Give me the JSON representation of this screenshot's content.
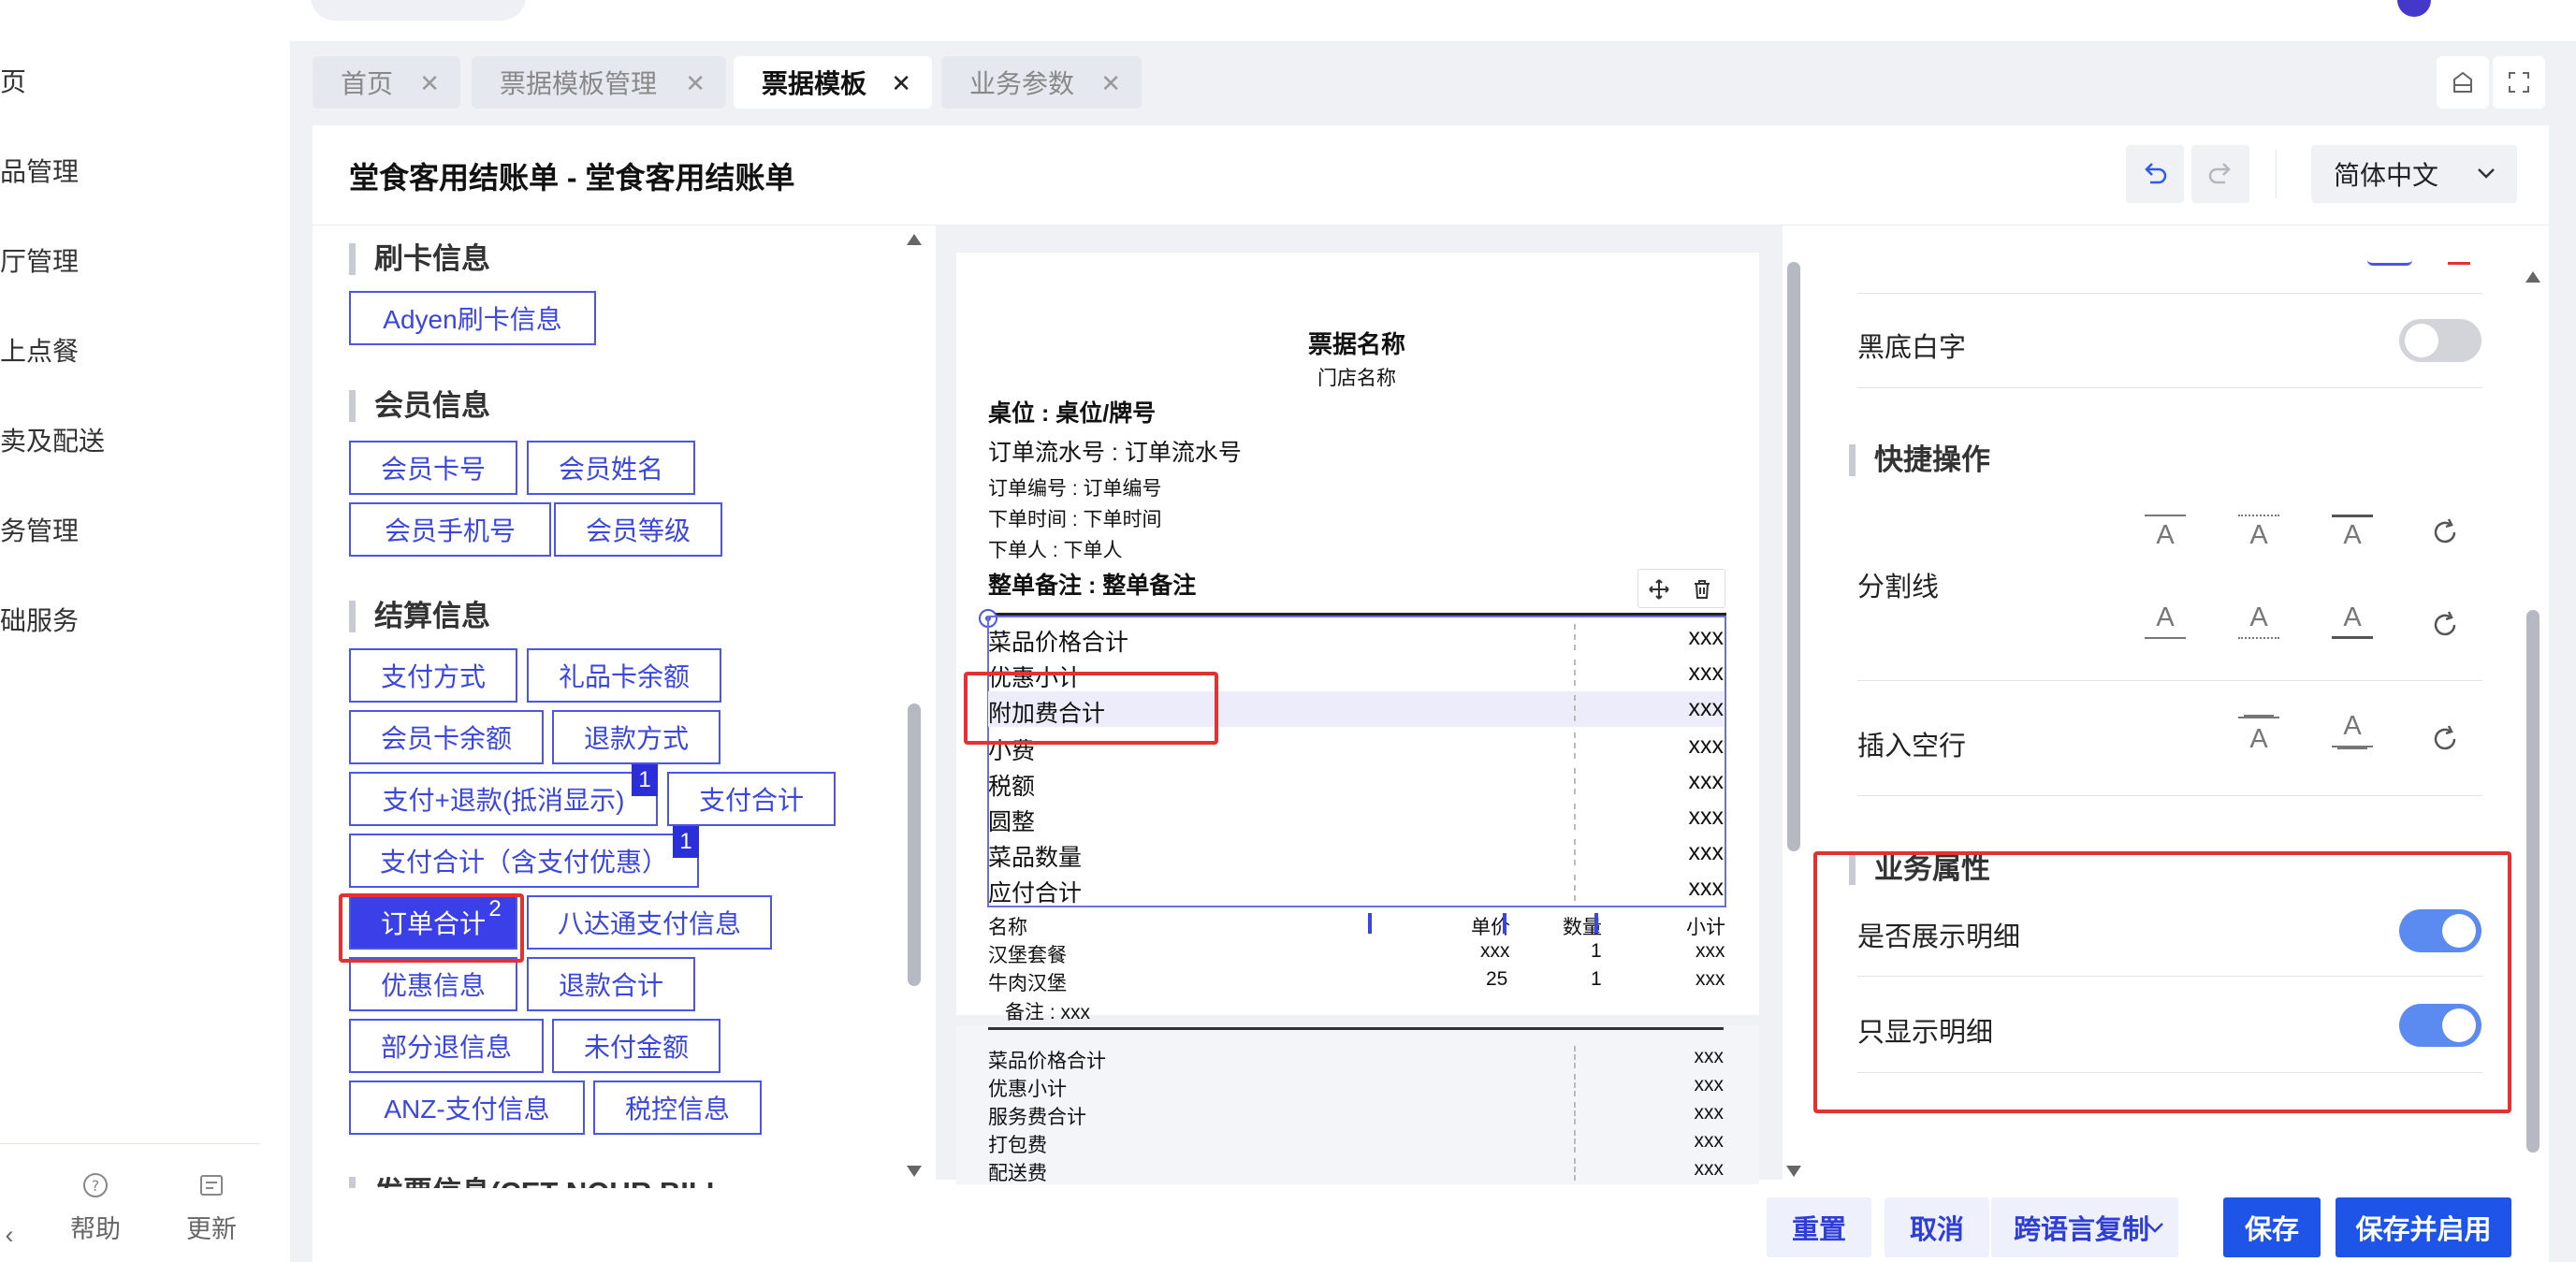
{
  "sidebar": {
    "items": [
      "页",
      "品管理",
      "厅管理",
      "上点餐",
      "卖及配送",
      "务管理",
      "础服务"
    ],
    "footer": {
      "help": "帮助",
      "update": "更新"
    }
  },
  "tabs": [
    {
      "label": "首页"
    },
    {
      "label": "票据模板管理"
    },
    {
      "label": "票据模板"
    },
    {
      "label": "业务参数"
    }
  ],
  "header": {
    "title": "堂食客用结账单 - 堂食客用结账单",
    "language": "简体中文"
  },
  "fields": {
    "card_section": "刷卡信息",
    "card_buttons": [
      "Adyen刷卡信息"
    ],
    "member_section": "会员信息",
    "member_buttons": [
      "会员卡号",
      "会员姓名",
      "会员手机号",
      "会员等级"
    ],
    "settle_section": "结算信息",
    "settle_buttons": [
      "支付方式",
      "礼品卡余额",
      "会员卡余额",
      "退款方式",
      "支付+退款(抵消显示)",
      "支付合计",
      "支付合计（含支付优惠）",
      "订单合计",
      "八达通支付信息",
      "优惠信息",
      "退款合计",
      "部分退信息",
      "未付金额",
      "ANZ-支付信息",
      "税控信息"
    ],
    "badges": [
      "1",
      "1",
      "2"
    ],
    "cut_section": "发票信息(CET NOUR BILL"
  },
  "preview": {
    "ticket_name": "票据名称",
    "store_name": "门店名称",
    "table": "桌位 : 桌位/牌号",
    "serial": "订单流水号 : 订单流水号",
    "order_no": "订单编号 : 订单编号",
    "order_time": "下单时间 : 下单时间",
    "orderer": "下单人 : 下单人",
    "remark": "整单备注 : 整单备注",
    "summary_rows": [
      {
        "label": "菜品价格合计",
        "value": "xxx"
      },
      {
        "label": "优惠小计",
        "value": "xxx"
      },
      {
        "label": "附加费合计",
        "value": "xxx"
      },
      {
        "label": "小费",
        "value": "xxx"
      },
      {
        "label": "税额",
        "value": "xxx"
      },
      {
        "label": "圆整",
        "value": "xxx"
      },
      {
        "label": "菜品数量",
        "value": "xxx"
      },
      {
        "label": "应付合计",
        "value": "xxx"
      }
    ],
    "detail_headers": [
      "名称",
      "单价",
      "数量",
      "小计"
    ],
    "detail_rows": [
      {
        "name": "汉堡套餐",
        "price": "xxx",
        "qty": "1",
        "subtotal": "xxx"
      },
      {
        "name": "牛肉汉堡",
        "price": "25",
        "qty": "1",
        "subtotal": "xxx"
      }
    ],
    "detail_remark": "备注 : xxx",
    "page2_rows": [
      {
        "label": "菜品价格合计",
        "value": "xxx"
      },
      {
        "label": "优惠小计",
        "value": "xxx"
      },
      {
        "label": "服务费合计",
        "value": "xxx"
      },
      {
        "label": "打包费",
        "value": "xxx"
      },
      {
        "label": "配送费",
        "value": "xxx"
      }
    ]
  },
  "properties": {
    "black_bg_label": "黑底白字",
    "black_bg_on": false,
    "quick_section": "快捷操作",
    "divider_label": "分割线",
    "insert_blank_label": "插入空行",
    "glyph": "A",
    "business_section": "业务属性",
    "show_detail_label": "是否展示明细",
    "show_detail_on": true,
    "only_detail_label": "只显示明细",
    "only_detail_on": true
  },
  "footer_buttons": {
    "reset": "重置",
    "cancel": "取消",
    "copy_lang": "跨语言复制",
    "save": "保存",
    "save_enable": "保存并启用"
  },
  "colors": {
    "accent": "#3a3fe8",
    "primary_button": "#1e55e8",
    "highlight_red": "#e43131",
    "toggle_on": "#5b8bf0"
  }
}
